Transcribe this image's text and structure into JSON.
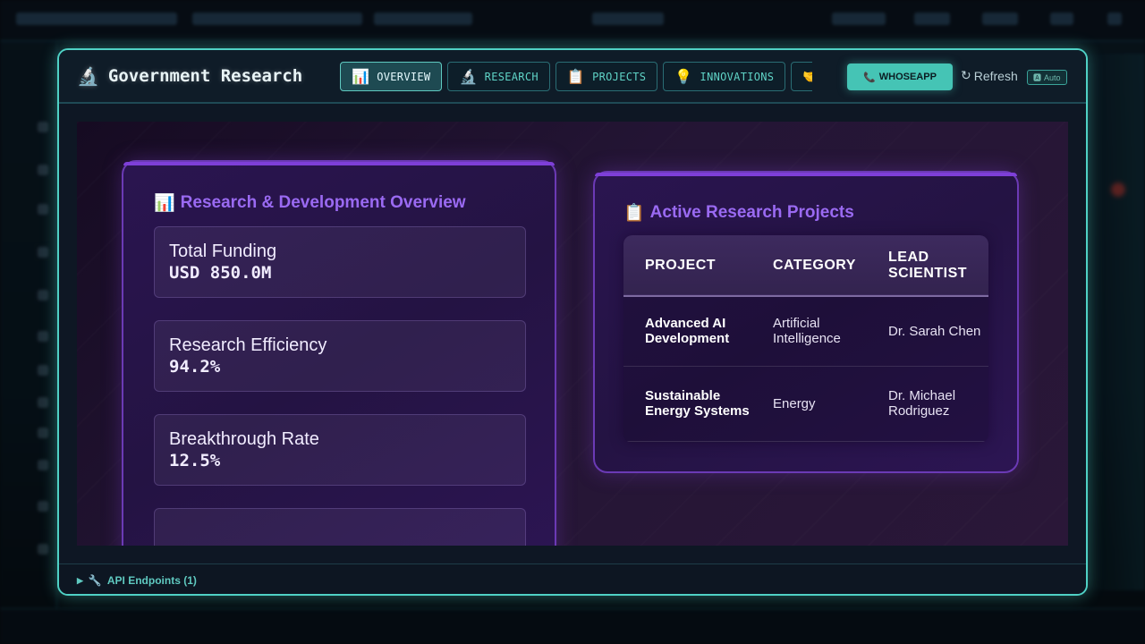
{
  "modal": {
    "title": "Government Research",
    "title_icon": "microscope-icon",
    "tabs": [
      {
        "label": "OVERVIEW",
        "icon": "bar-chart-icon",
        "glyph": "📊",
        "active": true
      },
      {
        "label": "RESEARCH",
        "icon": "microscope-icon",
        "glyph": "🔬",
        "active": false
      },
      {
        "label": "PROJECTS",
        "icon": "clipboard-icon",
        "glyph": "📋",
        "active": false
      },
      {
        "label": "INNOVATIONS",
        "icon": "lightbulb-icon",
        "glyph": "💡",
        "active": false
      },
      {
        "label": "",
        "icon": "handshake-icon",
        "glyph": "🤝",
        "active": false
      }
    ],
    "whoseapp_label": "WHOSEAPP",
    "refresh_label": "Refresh",
    "auto_label": "Auto"
  },
  "overview": {
    "title": "Research & Development Overview",
    "metrics": [
      {
        "label": "Total Funding",
        "value": "USD 850.0M"
      },
      {
        "label": "Research Efficiency",
        "value": "94.2%"
      },
      {
        "label": "Breakthrough Rate",
        "value": "12.5%"
      }
    ]
  },
  "projects": {
    "title": "Active Research Projects",
    "columns": [
      "PROJECT",
      "CATEGORY",
      "LEAD SCIENTIST"
    ],
    "rows": [
      {
        "project": "Advanced AI Development",
        "category": "Artificial Intelligence",
        "lead": "Dr. Sarah Chen"
      },
      {
        "project": "Sustainable Energy Systems",
        "category": "Energy",
        "lead": "Dr. Michael Rodriguez"
      }
    ]
  },
  "footer": {
    "api_label": "API Endpoints (1)"
  },
  "colors": {
    "accent": "#4fd1c5",
    "purple_title": "#9a6af2",
    "card_border": "#6b3ab5"
  }
}
